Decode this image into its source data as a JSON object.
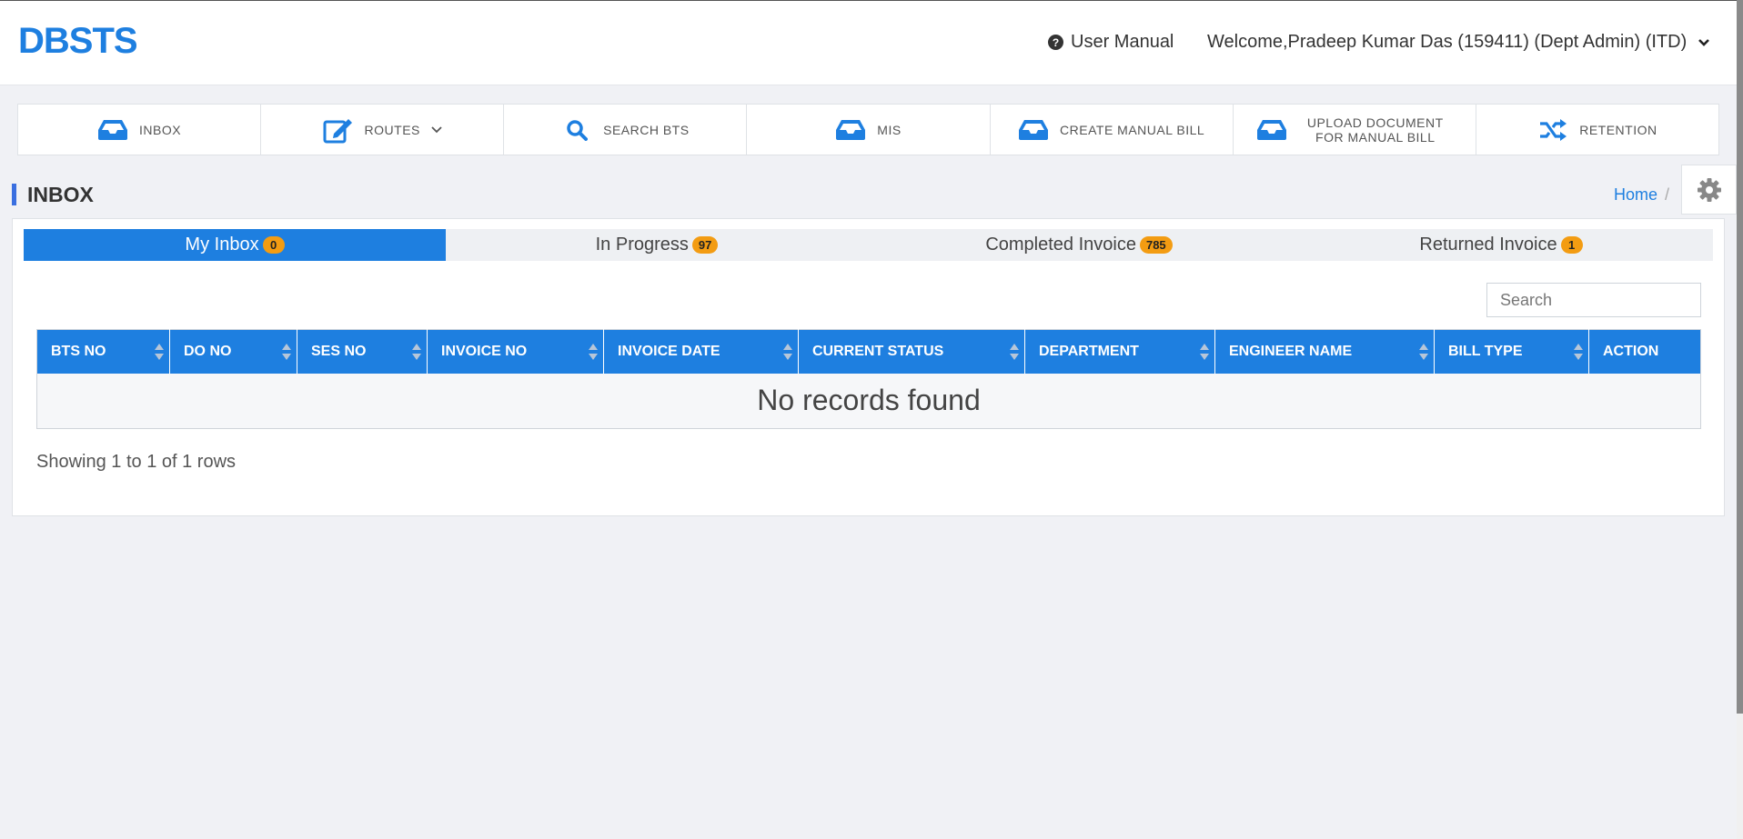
{
  "app": {
    "logo": "DBSTS"
  },
  "header": {
    "user_manual": "User Manual",
    "welcome": "Welcome,Pradeep Kumar Das (159411) (Dept Admin) (ITD)"
  },
  "nav": [
    {
      "label": "INBOX",
      "icon": "inbox-icon"
    },
    {
      "label": "ROUTES",
      "icon": "edit-icon"
    },
    {
      "label": "SEARCH BTS",
      "icon": "search-icon"
    },
    {
      "label": "MIS",
      "icon": "inbox-icon"
    },
    {
      "label": "CREATE MANUAL BILL",
      "icon": "inbox-icon"
    },
    {
      "label": "UPLOAD DOCUMENT FOR MANUAL BILL",
      "icon": "inbox-icon"
    },
    {
      "label": "RETENTION",
      "icon": "shuffle-icon"
    }
  ],
  "page": {
    "title": "INBOX",
    "breadcrumb_home": "Home",
    "breadcrumb_sep": "/"
  },
  "tabs": [
    {
      "label": "My Inbox",
      "count": "0",
      "active": true
    },
    {
      "label": "In Progress",
      "count": "97",
      "active": false
    },
    {
      "label": "Completed Invoice",
      "count": "785",
      "active": false
    },
    {
      "label": "Returned Invoice",
      "count": "1",
      "active": false
    }
  ],
  "search": {
    "placeholder": "Search"
  },
  "table": {
    "columns": [
      "BTS NO",
      "DO NO",
      "SES NO",
      "INVOICE NO",
      "INVOICE DATE",
      "CURRENT STATUS",
      "DEPARTMENT",
      "ENGINEER NAME",
      "BILL TYPE",
      "ACTION"
    ],
    "empty_message": "No records found"
  },
  "pagination": {
    "summary": "Showing 1 to 1 of 1 rows"
  },
  "colors": {
    "primary": "#1e7fe0",
    "badge": "#f39c12",
    "background": "#f0f1f5"
  }
}
